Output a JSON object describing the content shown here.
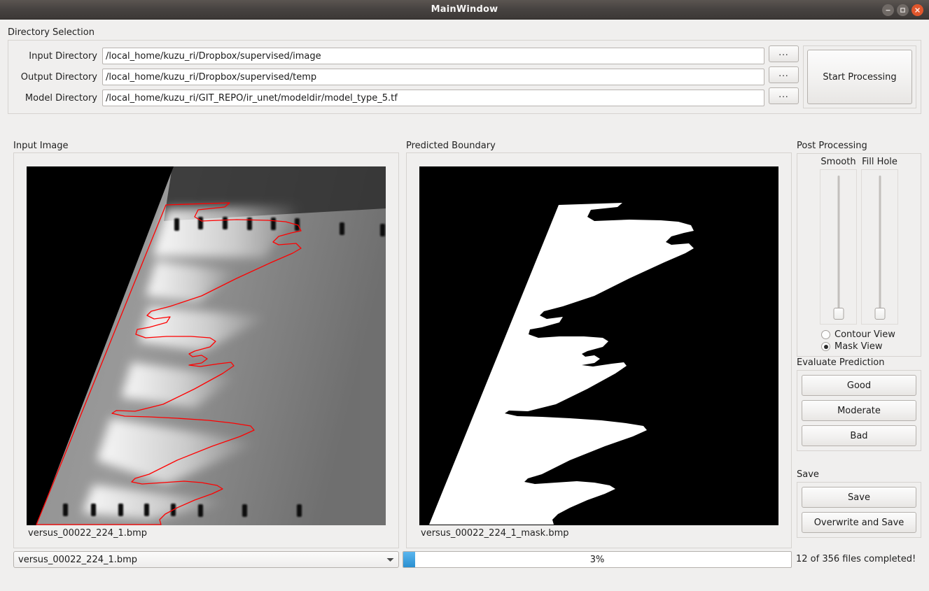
{
  "window": {
    "title": "MainWindow",
    "controls": [
      {
        "name": "minimize",
        "glyph": "minus"
      },
      {
        "name": "maximize",
        "glyph": "square"
      },
      {
        "name": "close",
        "glyph": "cross"
      }
    ]
  },
  "directory_selection": {
    "group_title": "Directory Selection",
    "rows": [
      {
        "label": "Input Directory",
        "value": "/local_home/kuzu_ri/Dropbox/supervised/image",
        "browse_label": "..."
      },
      {
        "label": "Output Directory",
        "value": "/local_home/kuzu_ri/Dropbox/supervised/temp",
        "browse_label": "..."
      },
      {
        "label": "Model Directory",
        "value": "/local_home/kuzu_ri/GIT_REPO/ir_unet/modeldir/model_type_5.tf",
        "browse_label": "..."
      }
    ],
    "start_button": "Start Processing"
  },
  "input_panel": {
    "title": "Input Image",
    "caption": "versus_00022_224_1.bmp"
  },
  "predicted_panel": {
    "title": "Predicted Boundary",
    "caption": "versus_00022_224_1_mask.bmp"
  },
  "post_processing": {
    "group_title": "Post Processing",
    "sliders": [
      {
        "label": "Smooth",
        "value": 0
      },
      {
        "label": "Fill Hole",
        "value": 0
      }
    ],
    "view_options": [
      {
        "label": "Contour View",
        "selected": false
      },
      {
        "label": "Mask View",
        "selected": true
      }
    ]
  },
  "evaluate_prediction": {
    "group_title": "Evaluate Prediction",
    "buttons": [
      "Good",
      "Moderate",
      "Bad"
    ]
  },
  "save": {
    "group_title": "Save",
    "buttons": [
      "Save",
      "Overwrite and Save"
    ]
  },
  "bottom_bar": {
    "file_combo": {
      "value": "versus_00022_224_1.bmp",
      "arrow_icon": "chevron-down-icon"
    },
    "progress": {
      "percent": 3,
      "text": "3%"
    },
    "status": "12 of 356 files completed!"
  },
  "colors": {
    "window_bg": "#f0efee",
    "titlebar": "#474341",
    "contour": "#ff0000",
    "progress_chunk": "#2a8fd0",
    "close_button": "#e0562c"
  }
}
